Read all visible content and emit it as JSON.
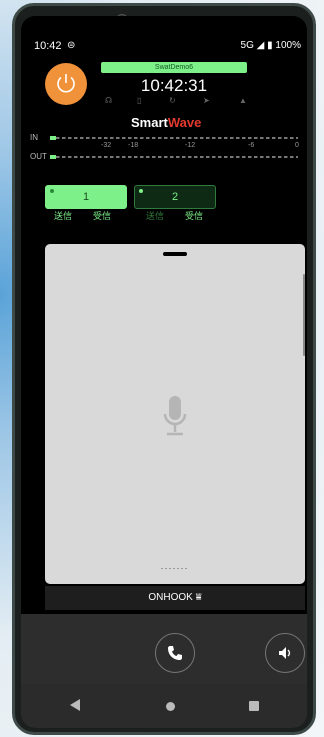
{
  "status": {
    "time": "10:42",
    "network": "5G",
    "battery": "100%"
  },
  "connection": {
    "name": "SwatDemo6",
    "clock": "10:42:31"
  },
  "logo": {
    "text_a": "Smart",
    "text_b": "Wave"
  },
  "meters": {
    "in_label": "IN",
    "out_label": "OUT",
    "scale": [
      "-32",
      "-18",
      "-12",
      "-6",
      "0"
    ]
  },
  "channels": [
    {
      "number": "1",
      "send": "送信",
      "receive": "受信",
      "active": true
    },
    {
      "number": "2",
      "send": "送信",
      "receive": "受信",
      "active": false
    }
  ],
  "onhook": {
    "label": "ONHOOK ⩸"
  },
  "colors": {
    "accent": "#7df08a",
    "power": "#f0923a",
    "logo_red": "#e33a2e"
  }
}
